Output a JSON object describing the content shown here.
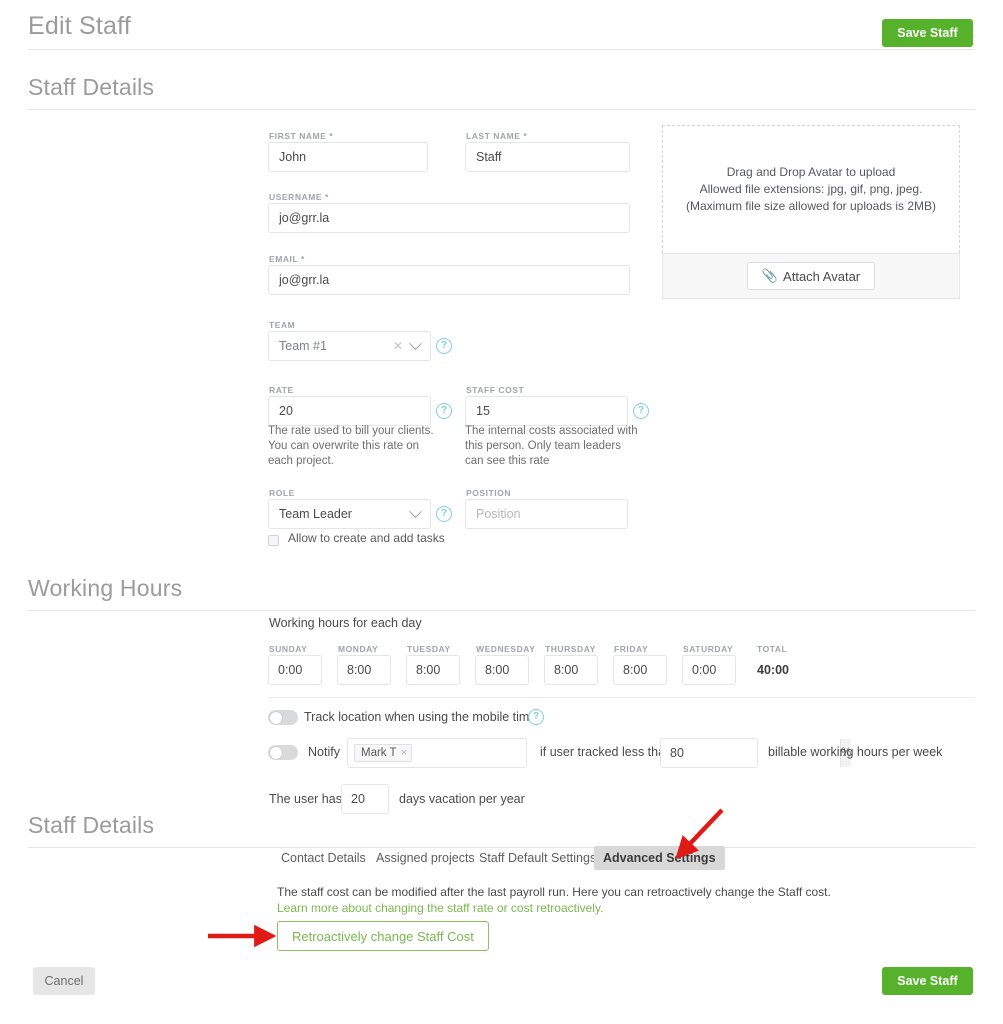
{
  "header": {
    "title": "Edit Staff",
    "save_label": "Save Staff"
  },
  "sections": {
    "staff_details": "Staff Details",
    "working_hours": "Working Hours",
    "staff_details_2": "Staff Details"
  },
  "form": {
    "first_name": {
      "label": "FIRST NAME *",
      "value": "John"
    },
    "last_name": {
      "label": "LAST NAME *",
      "value": "Staff"
    },
    "username": {
      "label": "USERNAME *",
      "value": "jo@grr.la"
    },
    "email": {
      "label": "EMAIL *",
      "value": "jo@grr.la"
    },
    "team": {
      "label": "TEAM",
      "value": "Team #1"
    },
    "rate": {
      "label": "RATE",
      "value": "20",
      "help": "The rate used to bill your clients. You can overwrite this rate on each project."
    },
    "staff_cost": {
      "label": "STAFF COST",
      "value": "15",
      "help": "The internal costs associated with this person. Only team leaders can see this rate"
    },
    "role": {
      "label": "ROLE",
      "value": "Team Leader"
    },
    "position": {
      "label": "POSITION",
      "value": "",
      "placeholder": "Position"
    },
    "allow_tasks": {
      "label": "Allow to create and add tasks",
      "checked": false
    },
    "help_icon": "?"
  },
  "avatar": {
    "line1": "Drag and Drop Avatar to upload",
    "line2": "Allowed file extensions: jpg, gif, png, jpeg.",
    "line3": "(Maximum file size allowed for uploads is 2MB)",
    "attach_label": "Attach Avatar",
    "attach_icon": "paperclip-icon"
  },
  "working_hours": {
    "caption": "Working hours for each day",
    "days": [
      {
        "label": "SUNDAY",
        "value": "0:00"
      },
      {
        "label": "MONDAY",
        "value": "8:00"
      },
      {
        "label": "TUESDAY",
        "value": "8:00"
      },
      {
        "label": "WEDNESDAY",
        "value": "8:00"
      },
      {
        "label": "THURSDAY",
        "value": "8:00"
      },
      {
        "label": "FRIDAY",
        "value": "8:00"
      },
      {
        "label": "SATURDAY",
        "value": "0:00"
      }
    ],
    "total": {
      "label": "TOTAL",
      "value": "40:00"
    },
    "track_location": {
      "label": "Track location when using the mobile timer",
      "enabled": false
    },
    "notify": {
      "enabled": false,
      "prefix": "Notify",
      "tag": "Mark T",
      "tag_remove": "×",
      "middle": "if user tracked less than",
      "percent_value": "80",
      "percent_suffix": "%",
      "suffix": "billable working hours per week"
    },
    "vacation": {
      "prefix": "The user has",
      "value": "20",
      "suffix": "days vacation per year"
    }
  },
  "tabs": [
    {
      "label": "Contact Details",
      "active": false
    },
    {
      "label": "Assigned projects",
      "active": false
    },
    {
      "label": "Staff Default Settings",
      "active": false
    },
    {
      "label": "Advanced Settings",
      "active": true
    }
  ],
  "advanced": {
    "desc": "The staff cost can be modified after the last payroll run. Here you can retroactively change the Staff cost.",
    "link": "Learn more about changing the staff rate or cost retroactively.",
    "button": "Retroactively change Staff Cost"
  },
  "footer": {
    "cancel": "Cancel",
    "save": "Save Staff"
  },
  "colors": {
    "green": "#57b22b",
    "green_outline": "#8cc25c",
    "link_green": "#7ab84f",
    "annotation_red": "#e01b16"
  }
}
